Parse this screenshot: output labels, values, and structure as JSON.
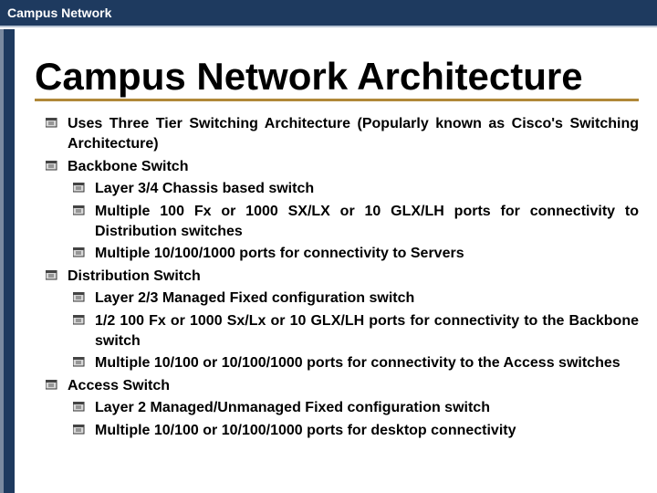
{
  "header": {
    "title": "Campus Network"
  },
  "slide": {
    "title": "Campus Network Architecture",
    "items": [
      {
        "text": "Uses Three Tier Switching Architecture (Popularly known as Cisco's Switching Architecture)"
      },
      {
        "text": "Backbone Switch",
        "sub": [
          "Layer 3/4 Chassis based switch",
          "Multiple 100 Fx or 1000 SX/LX or 10 GLX/LH ports for connectivity to Distribution switches",
          "Multiple 10/100/1000 ports for connectivity to Servers"
        ]
      },
      {
        "text": "Distribution Switch",
        "sub": [
          "Layer 2/3 Managed Fixed configuration switch",
          "1/2 100 Fx or 1000 Sx/Lx or 10 GLX/LH ports for connectivity to the Backbone switch",
          "Multiple 10/100 or 10/100/1000 ports for connectivity to the Access switches"
        ]
      },
      {
        "text": "Access Switch",
        "sub": [
          "Layer 2 Managed/Unmanaged Fixed configuration switch",
          "Multiple 10/100 or 10/100/1000 ports for desktop connectivity"
        ]
      }
    ]
  }
}
